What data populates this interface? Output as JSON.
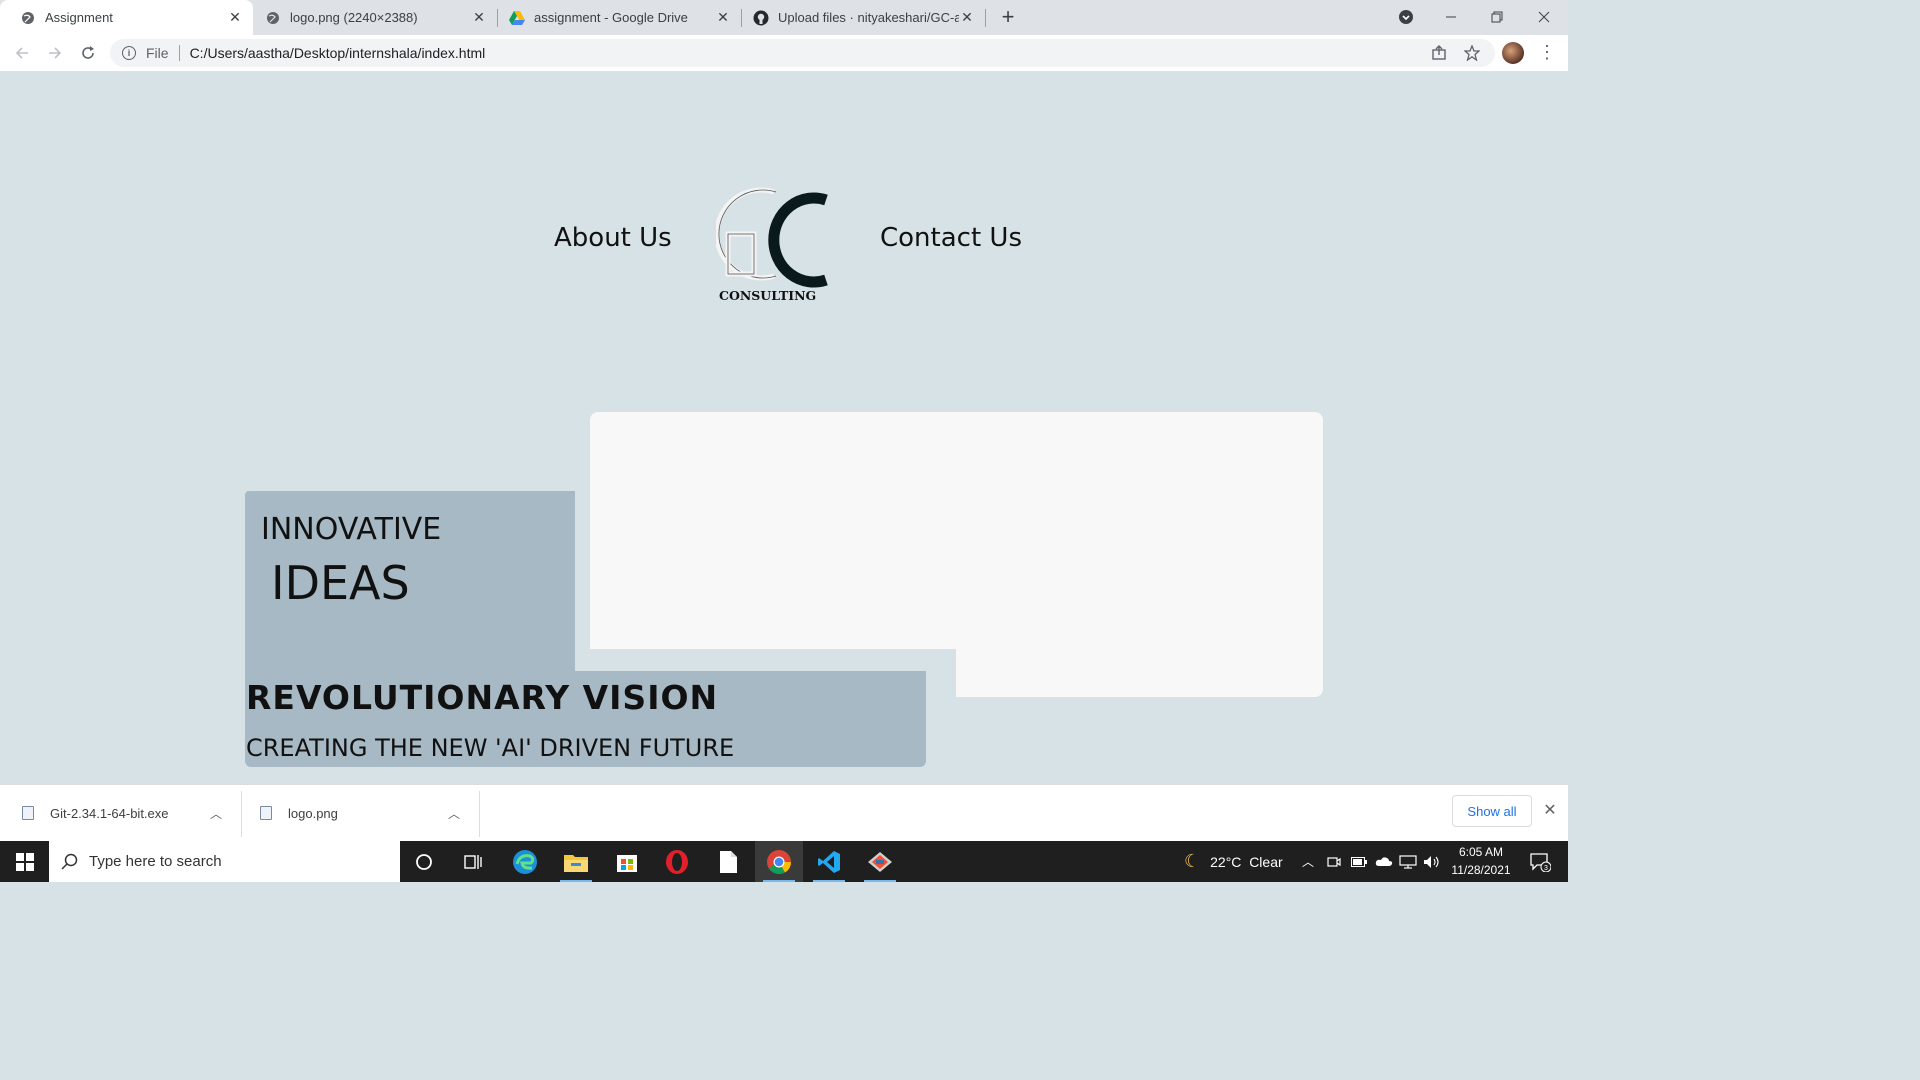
{
  "browser": {
    "tabs": [
      {
        "title": "Assignment",
        "active": true
      },
      {
        "title": "logo.png (2240×2388)",
        "active": false
      },
      {
        "title": "assignment - Google Drive",
        "active": false
      },
      {
        "title": "Upload files · nityakeshari/GC-as",
        "active": false
      }
    ],
    "address": {
      "scheme": "File",
      "url": "C:/Users/aastha/Desktop/internshala/index.html"
    }
  },
  "page": {
    "nav": {
      "about": "About Us",
      "contact": "Contact Us"
    },
    "logo": {
      "text": "CONSULTING"
    },
    "hero": {
      "line1": "INNOVATIVE",
      "line2": "IDEAS",
      "headline": "REVOLUTIONARY VISION",
      "tagline": "CREATING THE NEW 'AI' DRIVEN FUTURE"
    }
  },
  "downloads": {
    "items": [
      {
        "name": "Git-2.34.1-64-bit.exe"
      },
      {
        "name": "logo.png"
      }
    ],
    "show_all": "Show all"
  },
  "taskbar": {
    "search_placeholder": "Type here to search",
    "weather": "22°C  Clear",
    "time": "6:05 AM",
    "date": "11/28/2021",
    "notifications": "3"
  },
  "colors": {
    "page_bg": "#d7e2e7",
    "block_blue": "#a7b9c4",
    "card_white": "#f8f8f8",
    "link_blue": "#1a73e8"
  }
}
